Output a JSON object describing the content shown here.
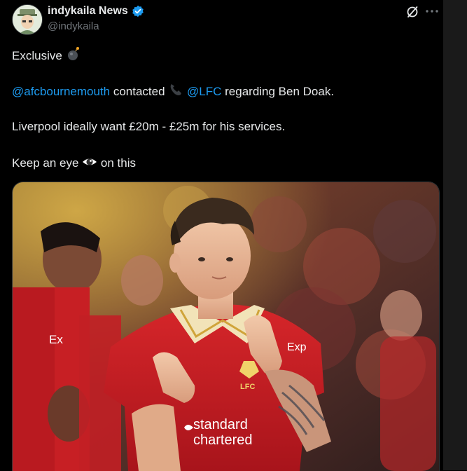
{
  "author": {
    "display_name": "indykaila News",
    "handle": "@indykaila"
  },
  "tweet": {
    "line1": {
      "text": "Exclusive"
    },
    "line2": {
      "mention1": "@afcbournemouth",
      "text1": " contacted ",
      "mention2": "@LFC",
      "text2": " regarding Ben Doak."
    },
    "line3": {
      "text": "Liverpool ideally want £20m - £25m for his services."
    },
    "line4": {
      "text1": "Keep an eye ",
      "text2": " on this"
    }
  },
  "media": {
    "description_icons": [
      "bomb-emoji",
      "telephone-emoji",
      "eye-emoji"
    ],
    "shirt_sponsor_line1": "standard",
    "shirt_sponsor_line2": "chartered",
    "shirt_badge": "LFC",
    "shirt_sleeve": "Exp",
    "left_player_sleeve": "Ex"
  },
  "colors": {
    "background": "#000000",
    "text": "#e7e9ea",
    "secondary_text": "#71767b",
    "mention": "#1d9bf0",
    "verified_badge": "#1d9bf0"
  }
}
